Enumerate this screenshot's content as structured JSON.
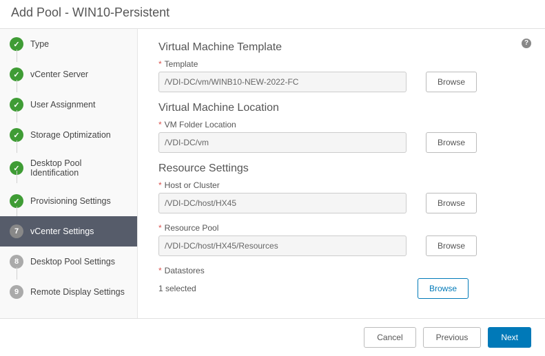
{
  "header": {
    "title": "Add Pool - WIN10-Persistent"
  },
  "sidebar": {
    "steps": [
      {
        "label": "Type",
        "status": "done"
      },
      {
        "label": "vCenter Server",
        "status": "done"
      },
      {
        "label": "User Assignment",
        "status": "done"
      },
      {
        "label": "Storage Optimization",
        "status": "done"
      },
      {
        "label": "Desktop Pool Identification",
        "status": "done"
      },
      {
        "label": "Provisioning Settings",
        "status": "done"
      },
      {
        "label": "vCenter Settings",
        "status": "current",
        "num": "7"
      },
      {
        "label": "Desktop Pool Settings",
        "status": "pending",
        "num": "8"
      },
      {
        "label": "Remote Display Settings",
        "status": "pending",
        "num": "9"
      }
    ]
  },
  "sections": {
    "vmTemplate": {
      "title": "Virtual Machine Template",
      "templateLabel": "Template",
      "templateValue": "/VDI-DC/vm/WINB10-NEW-2022-FC",
      "browse": "Browse"
    },
    "vmLocation": {
      "title": "Virtual Machine Location",
      "folderLabel": "VM Folder Location",
      "folderValue": "/VDI-DC/vm",
      "browse": "Browse"
    },
    "resource": {
      "title": "Resource Settings",
      "hostLabel": "Host or Cluster",
      "hostValue": "/VDI-DC/host/HX45",
      "poolLabel": "Resource Pool",
      "poolValue": "/VDI-DC/host/HX45/Resources",
      "datastoresLabel": "Datastores",
      "selectedText": "1 selected",
      "browse": "Browse"
    }
  },
  "footer": {
    "cancel": "Cancel",
    "previous": "Previous",
    "next": "Next"
  }
}
